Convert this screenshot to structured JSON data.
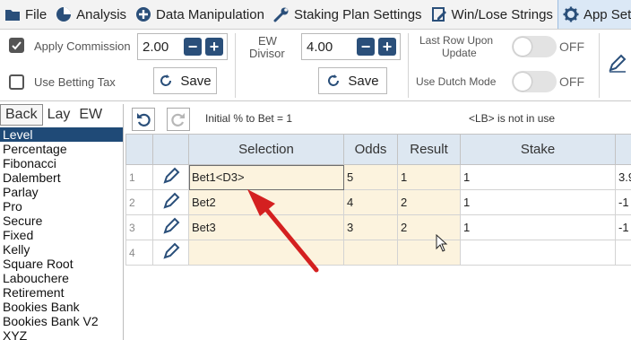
{
  "menu": [
    {
      "label": "File",
      "icon": "folder-icon"
    },
    {
      "label": "Analysis",
      "icon": "pie-chart-icon"
    },
    {
      "label": "Data Manipulation",
      "icon": "plus-circle-icon"
    },
    {
      "label": "Staking Plan Settings",
      "icon": "wrench-icon"
    },
    {
      "label": "Win/Lose Strings",
      "icon": "edit-doc-icon"
    },
    {
      "label": "App Setti",
      "icon": "gear-icon",
      "active": true
    }
  ],
  "ribbon": {
    "apply_commission_label": "Apply Commission",
    "apply_commission_checked": true,
    "commission_value": "2.00",
    "use_betting_tax_label": "Use Betting Tax",
    "use_betting_tax_checked": false,
    "save1_label": "Save",
    "ew_divisor_label_1": "EW",
    "ew_divisor_label_2": "Divisor",
    "ew_divisor_value": "4.00",
    "save2_label": "Save",
    "last_row_label_1": "Last Row Upon",
    "last_row_label_2": "Update",
    "last_row_state": "OFF",
    "use_dutch_label": "Use Dutch Mode",
    "use_dutch_state": "OFF",
    "minus": "−",
    "plus": "+"
  },
  "left_panel": {
    "tabs": [
      "Back",
      "Lay",
      "EW"
    ],
    "active_tab": "Back",
    "plans": [
      "Level",
      "Percentage",
      "Fibonacci",
      "Dalembert",
      "Parlay",
      "Pro",
      "Secure",
      "Fixed",
      "Kelly",
      "Square Root",
      "Labouchere",
      "Retirement",
      "Bookies Bank",
      "Bookies Bank V2",
      "XYZ"
    ],
    "selected": "Level"
  },
  "toolbar": {
    "initial_pct_text": "Initial % to Bet = 1",
    "lb_text": "<LB> is not in use"
  },
  "grid": {
    "columns": [
      "Selection",
      "Odds",
      "Result",
      "Stake"
    ],
    "rows": [
      {
        "num": "1",
        "selection": "Bet1<D3>",
        "odds": "5",
        "result": "1",
        "stake": "1",
        "extra": "3.9"
      },
      {
        "num": "2",
        "selection": "Bet2",
        "odds": "4",
        "result": "2",
        "stake": "1",
        "extra": "-1"
      },
      {
        "num": "3",
        "selection": "Bet3",
        "odds": "3",
        "result": "2",
        "stake": "1",
        "extra": "-1"
      },
      {
        "num": "4",
        "selection": "",
        "odds": "",
        "result": "",
        "stake": "",
        "extra": ""
      }
    ]
  },
  "colors": {
    "accent": "#2a4f7a",
    "selected_row": "#1f4a77",
    "header_bg": "#dde7f1",
    "cell_cream": "#fcf3de",
    "arrow": "#d42020"
  }
}
